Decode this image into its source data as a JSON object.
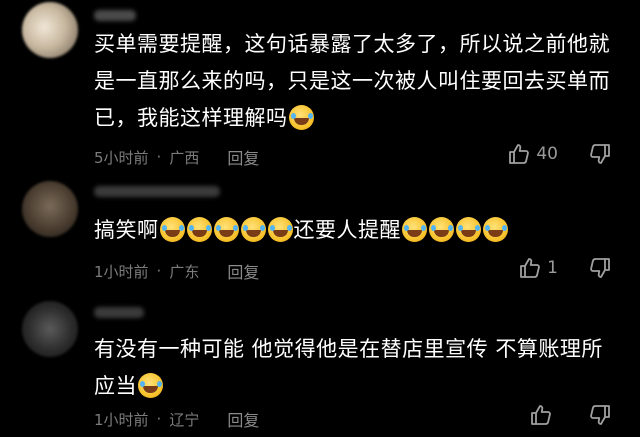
{
  "comments": [
    {
      "text_parts": [
        "买单需要提醒，这句话暴露了太多了，所以说之前他就是一直那么来的吗，只是这一次被人叫住要回去买单而已，我能这样理解吗"
      ],
      "time": "5小时前",
      "location": "广西",
      "reply_label": "回复",
      "likes": "40"
    },
    {
      "text_parts": [
        "搞笑啊",
        "还要人提醒"
      ],
      "time": "1小时前",
      "location": "广东",
      "reply_label": "回复",
      "likes": "1"
    },
    {
      "text_parts": [
        "有没有一种可能 他觉得他是在替店里宣传 不算账理所应当"
      ],
      "time": "1小时前",
      "location": "辽宁",
      "reply_label": "回复",
      "likes": ""
    }
  ],
  "separator": "·",
  "icons": [
    "thumbs-up-icon",
    "thumbs-down-icon",
    "laughing-tears-emoji"
  ],
  "colors": {
    "background": "#000000",
    "text": "#ffffff",
    "meta": "#7c7c7c"
  }
}
